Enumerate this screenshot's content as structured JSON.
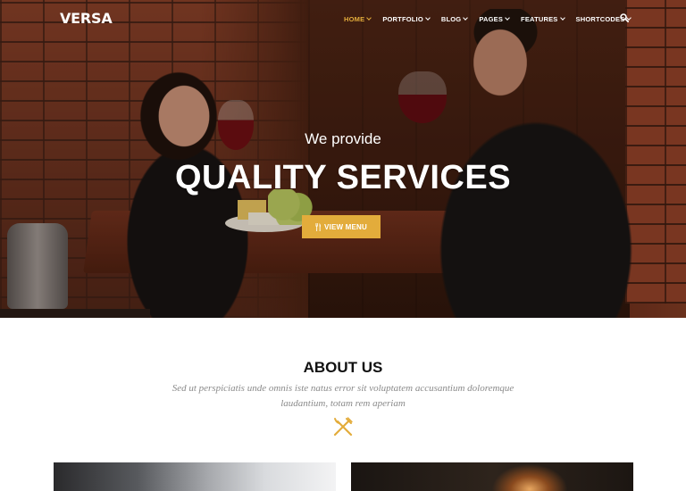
{
  "brand": {
    "logo": "VERSA"
  },
  "nav": {
    "items": [
      {
        "label": "HOME",
        "active": true,
        "has_dropdown": true
      },
      {
        "label": "PORTFOLIO",
        "active": false,
        "has_dropdown": true
      },
      {
        "label": "BLOG",
        "active": false,
        "has_dropdown": true
      },
      {
        "label": "PAGES",
        "active": false,
        "has_dropdown": true
      },
      {
        "label": "FEATURES",
        "active": false,
        "has_dropdown": true
      },
      {
        "label": "SHORTCODES",
        "active": false,
        "has_dropdown": true
      }
    ],
    "search_icon": "search-icon"
  },
  "hero": {
    "subtitle": "We provide",
    "title": "QUALITY SERVICES",
    "button": {
      "label": "VIEW MENU",
      "icon": "cutlery-icon"
    }
  },
  "about": {
    "title": "ABOUT US",
    "text": "Sed ut perspiciatis unde omnis iste natus error sit voluptatem accusantium doloremque laudantium, totam rem aperiam",
    "icon": "fork-knife-icon"
  },
  "colors": {
    "accent": "#e3ac3b",
    "text_dark": "#111111",
    "text_muted": "#8a8a8a"
  }
}
